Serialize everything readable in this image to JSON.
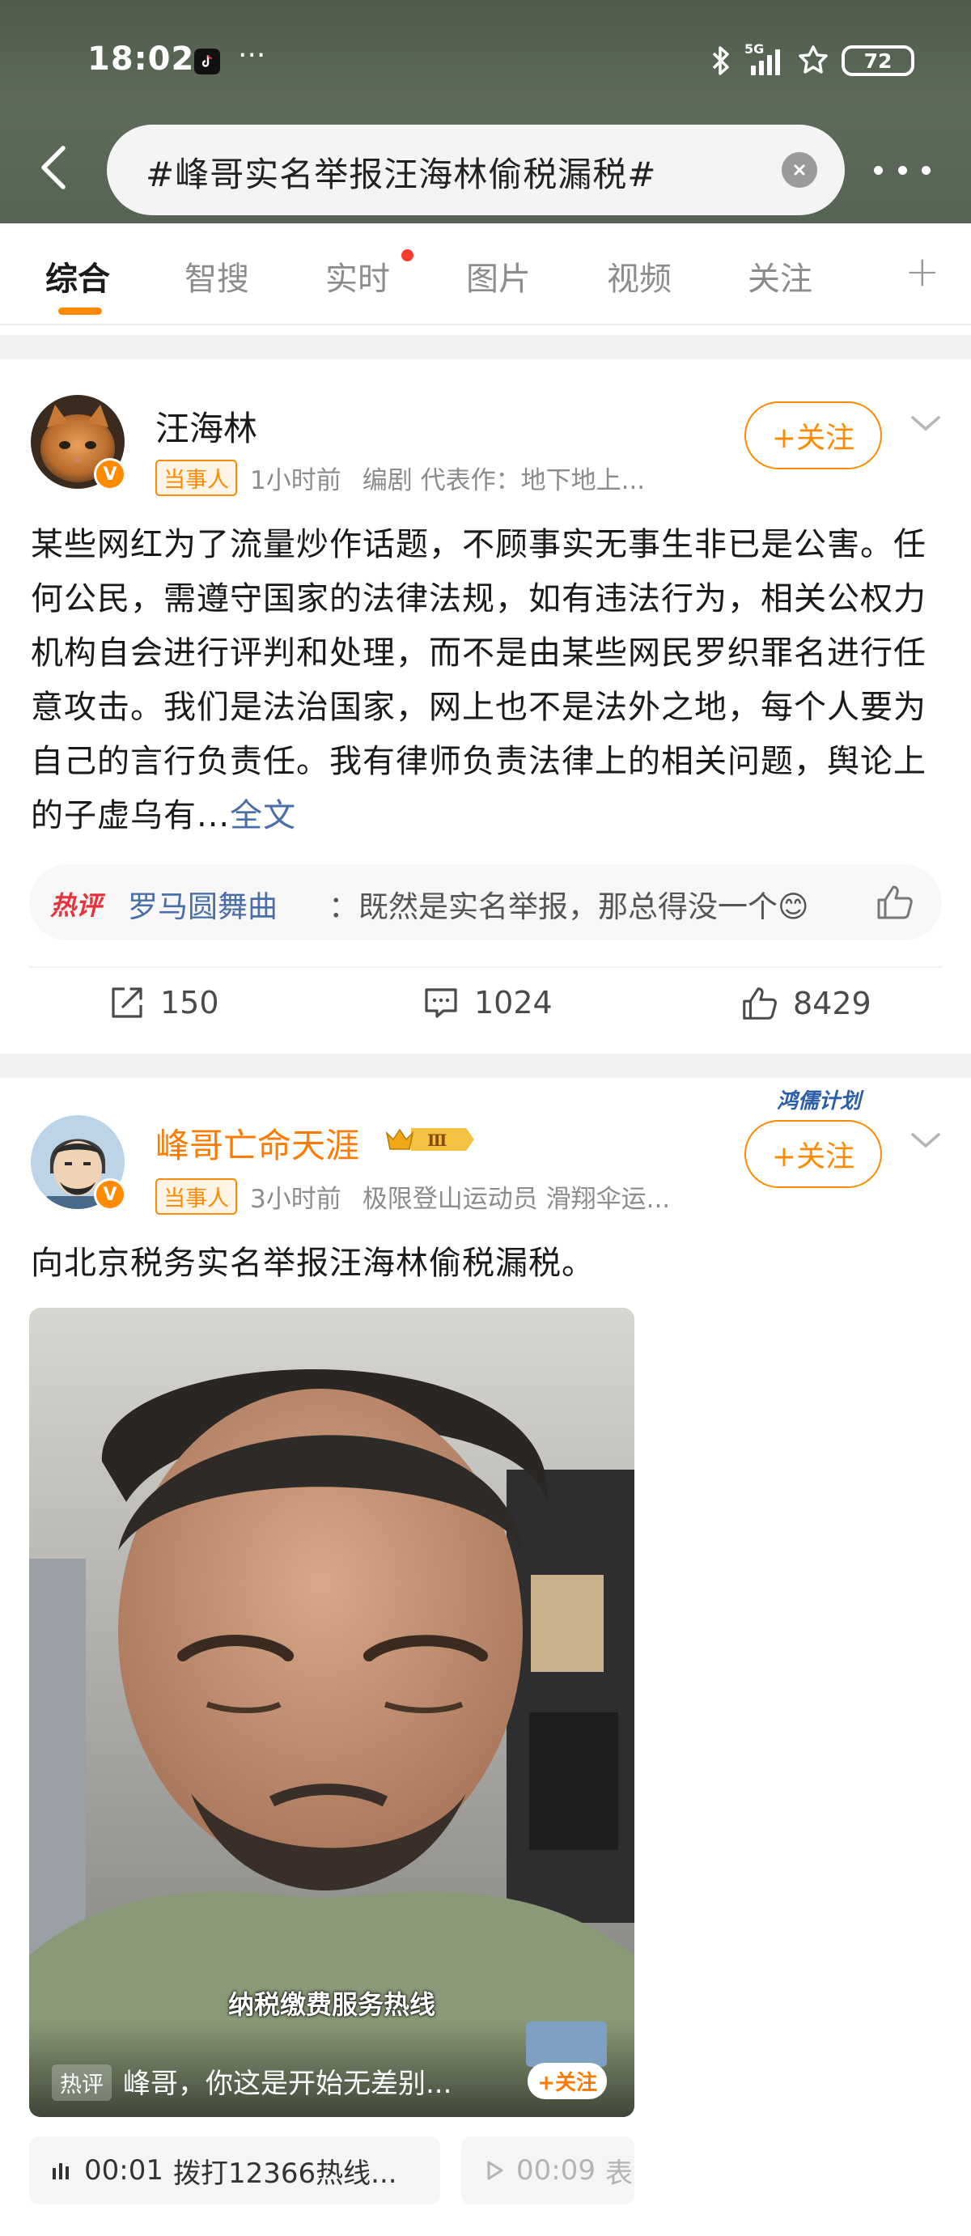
{
  "status_bar": {
    "time": "18:02",
    "dots": "···",
    "network": "5G",
    "battery": "72"
  },
  "search": {
    "query": "#峰哥实名举报汪海林偷税漏税#"
  },
  "tabs": [
    {
      "label": "综合",
      "active": true
    },
    {
      "label": "智搜"
    },
    {
      "label": "实时",
      "has_dot": true
    },
    {
      "label": "图片"
    },
    {
      "label": "视频"
    },
    {
      "label": "关注"
    }
  ],
  "posts": [
    {
      "author": "汪海林",
      "tag": "当事人",
      "time": "1小时前",
      "description": "编剧  代表作：地下地上...",
      "follow_label": "+关注",
      "body": "某些网红为了流量炒作话题，不顾事实无事生非已是公害。任何公民，需遵守国家的法律法规，如有违法行为，相关公权力机构自会进行评判和处理，而不是由某些网民罗织罪名进行任意攻击。我们是法治国家，网上也不是法外之地，每个人要为自己的言行负责任。我有律师负责法律上的相关问题，舆论上的子虚乌有...",
      "full_text_link": "全文",
      "hot_comment": {
        "badge": "热评",
        "user": "罗马圆舞曲",
        "text": "：既然是实名举报，那总得没一个😊"
      },
      "reposts": "150",
      "comments": "1024",
      "likes": "8429"
    },
    {
      "author": "峰哥亡命天涯",
      "level_badge": "Ⅲ",
      "plan_badge": "鸿儒计划",
      "tag": "当事人",
      "time": "3小时前",
      "description": "极限登山运动员 滑翔伞运...",
      "follow_label": "+关注",
      "body": "向北京税务实名举报汪海林偷税漏税。",
      "video": {
        "subtitle": "纳税缴费服务热线",
        "hot_tag": "热评",
        "hot_text": "峰哥，你这是开始无差别...",
        "follow": "+关注"
      },
      "audio_chips": [
        {
          "time": "00:01",
          "text": "拨打12366热线..."
        },
        {
          "time": "00:09",
          "text": "表"
        }
      ]
    }
  ],
  "colors": {
    "accent": "#ff8a00",
    "link": "#4a6ea8",
    "hot": "#e8323c",
    "header_bg": "#566454"
  }
}
